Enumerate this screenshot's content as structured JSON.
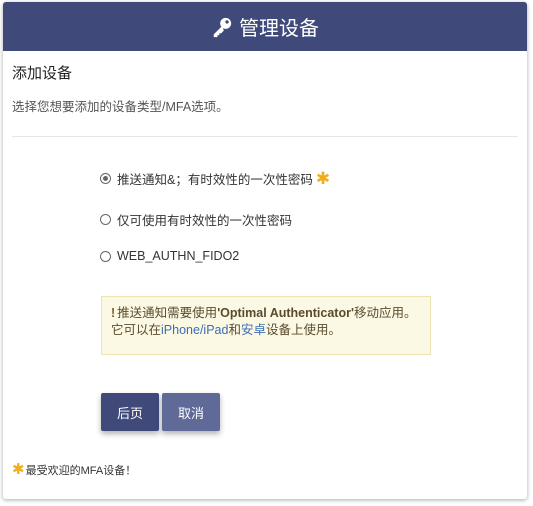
{
  "header": {
    "title": "管理设备",
    "icon": "key-icon",
    "background_color": "#3f4a7a"
  },
  "section": {
    "title": "添加设备",
    "description": "选择您想要添加的设备类型/MFA选项。"
  },
  "options": [
    {
      "label": "推送通知&；有时效性的一次性密码",
      "selected": true,
      "recommended": true
    },
    {
      "label": "仅可使用有时效性的一次性密码",
      "selected": false,
      "recommended": false
    },
    {
      "label": "WEB_AUTHN_FIDO2",
      "selected": false,
      "recommended": false
    }
  ],
  "notice": {
    "excl": "!",
    "text_1": "推送通知需要使用",
    "app_name": "'Optimal Authenticator'",
    "text_2": "移动应用。",
    "text_3": "它可以在",
    "link_ios": "iPhone/iPad",
    "text_4": "和",
    "link_android": "安卓",
    "text_5": "设备上使用。"
  },
  "buttons": {
    "back_label": "后页",
    "cancel_label": "取消"
  },
  "footnote": {
    "star": "✱",
    "text": "最受欢迎的MFA设备！"
  },
  "colors": {
    "accent": "#3f4a7a",
    "secondary": "#5f6a98",
    "star": "#f0ad1c",
    "notice_bg": "#fbf8e3",
    "link": "#3b6eb4"
  }
}
